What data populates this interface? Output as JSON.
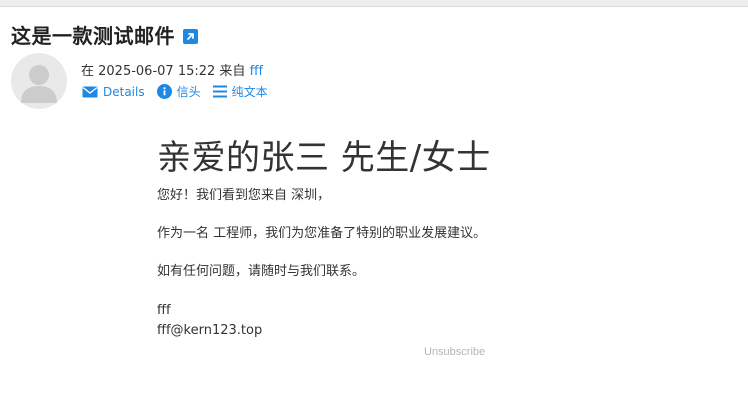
{
  "email": {
    "subject": "这是一款测试邮件",
    "meta_prefix": "在 2025-06-07 15:22 来自",
    "sender": "fff",
    "actions": {
      "details": "Details",
      "headers": "信头",
      "plain_text": "纯文本"
    }
  },
  "body": {
    "title": "亲爱的张三 先生/女士",
    "line1": "您好！我们看到您来自 深圳，",
    "line2": "作为一名 工程师，我们为您准备了特别的职业发展建议。",
    "line3": "如有任何问题，请随时与我们联系。",
    "signature_name": "fff",
    "signature_email": "fff@kern123.top",
    "unsubscribe": "Unsubscribe"
  },
  "colors": {
    "accent": "#1e88e5",
    "muted": "#b5b5b5"
  }
}
